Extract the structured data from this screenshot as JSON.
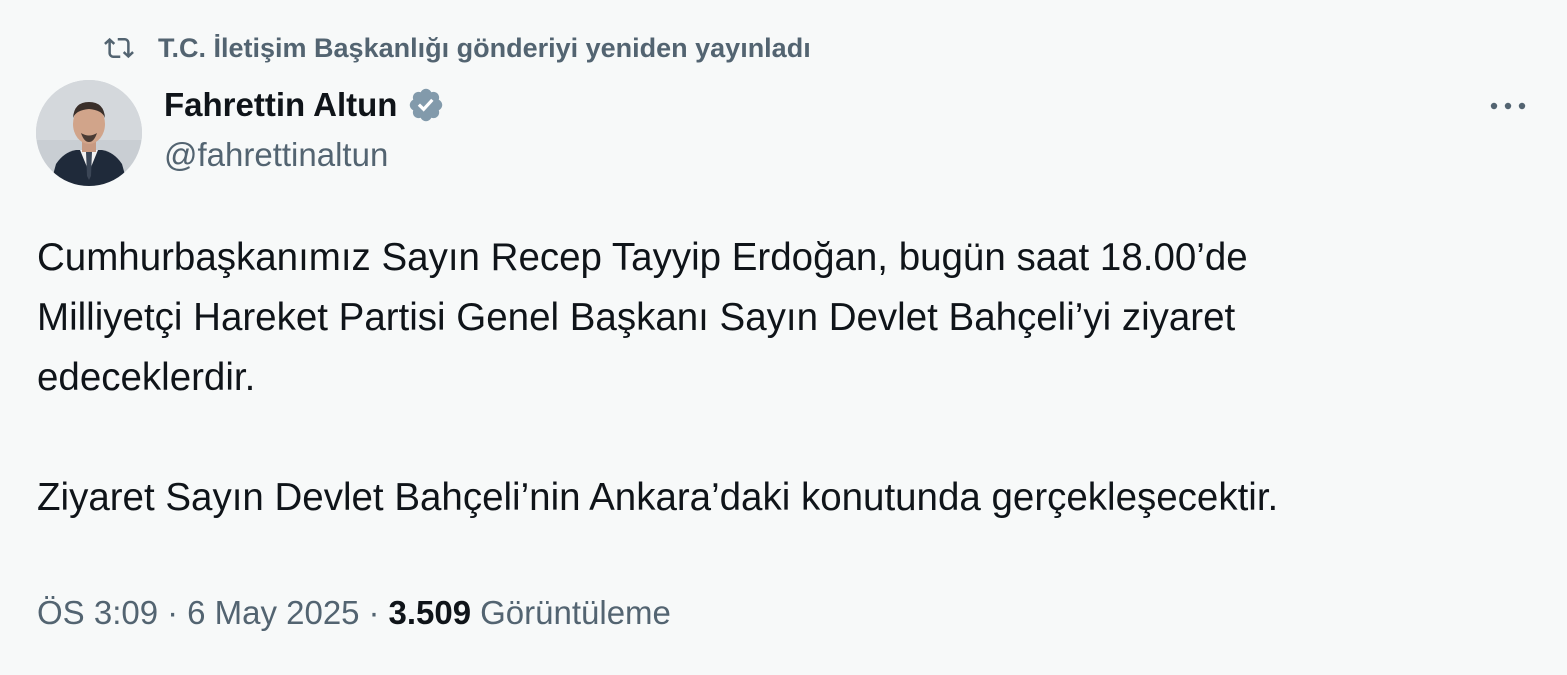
{
  "retweet": {
    "label": "T.C. İletişim Başkanlığı gönderiyi yeniden yayınladı",
    "icon": "retweet-icon"
  },
  "author": {
    "name": "Fahrettin Altun",
    "handle": "@fahrettinaltun",
    "verified_icon": "verified-badge-icon",
    "verified_color": "#829aab"
  },
  "more_icon": "more-horizontal-icon",
  "tweet": {
    "lines": [
      "Cumhurbaşkanımız Sayın Recep Tayyip Erdoğan, bugün saat 18.00’de",
      "Milliyetçi Hareket Partisi Genel Başkanı Sayın Devlet Bahçeli’yi ziyaret",
      "edeceklerdir.",
      "Ziyaret Sayın Devlet Bahçeli’nin Ankara’daki konutunda gerçekleşecektir."
    ]
  },
  "meta": {
    "time": "ÖS 3:09",
    "separator": "·",
    "date": "6 May 2025",
    "views_count": "3.509",
    "views_label": "Görüntüleme"
  },
  "colors": {
    "background": "#f7f9f9",
    "text_primary": "#0f1419",
    "text_secondary": "#536471"
  }
}
